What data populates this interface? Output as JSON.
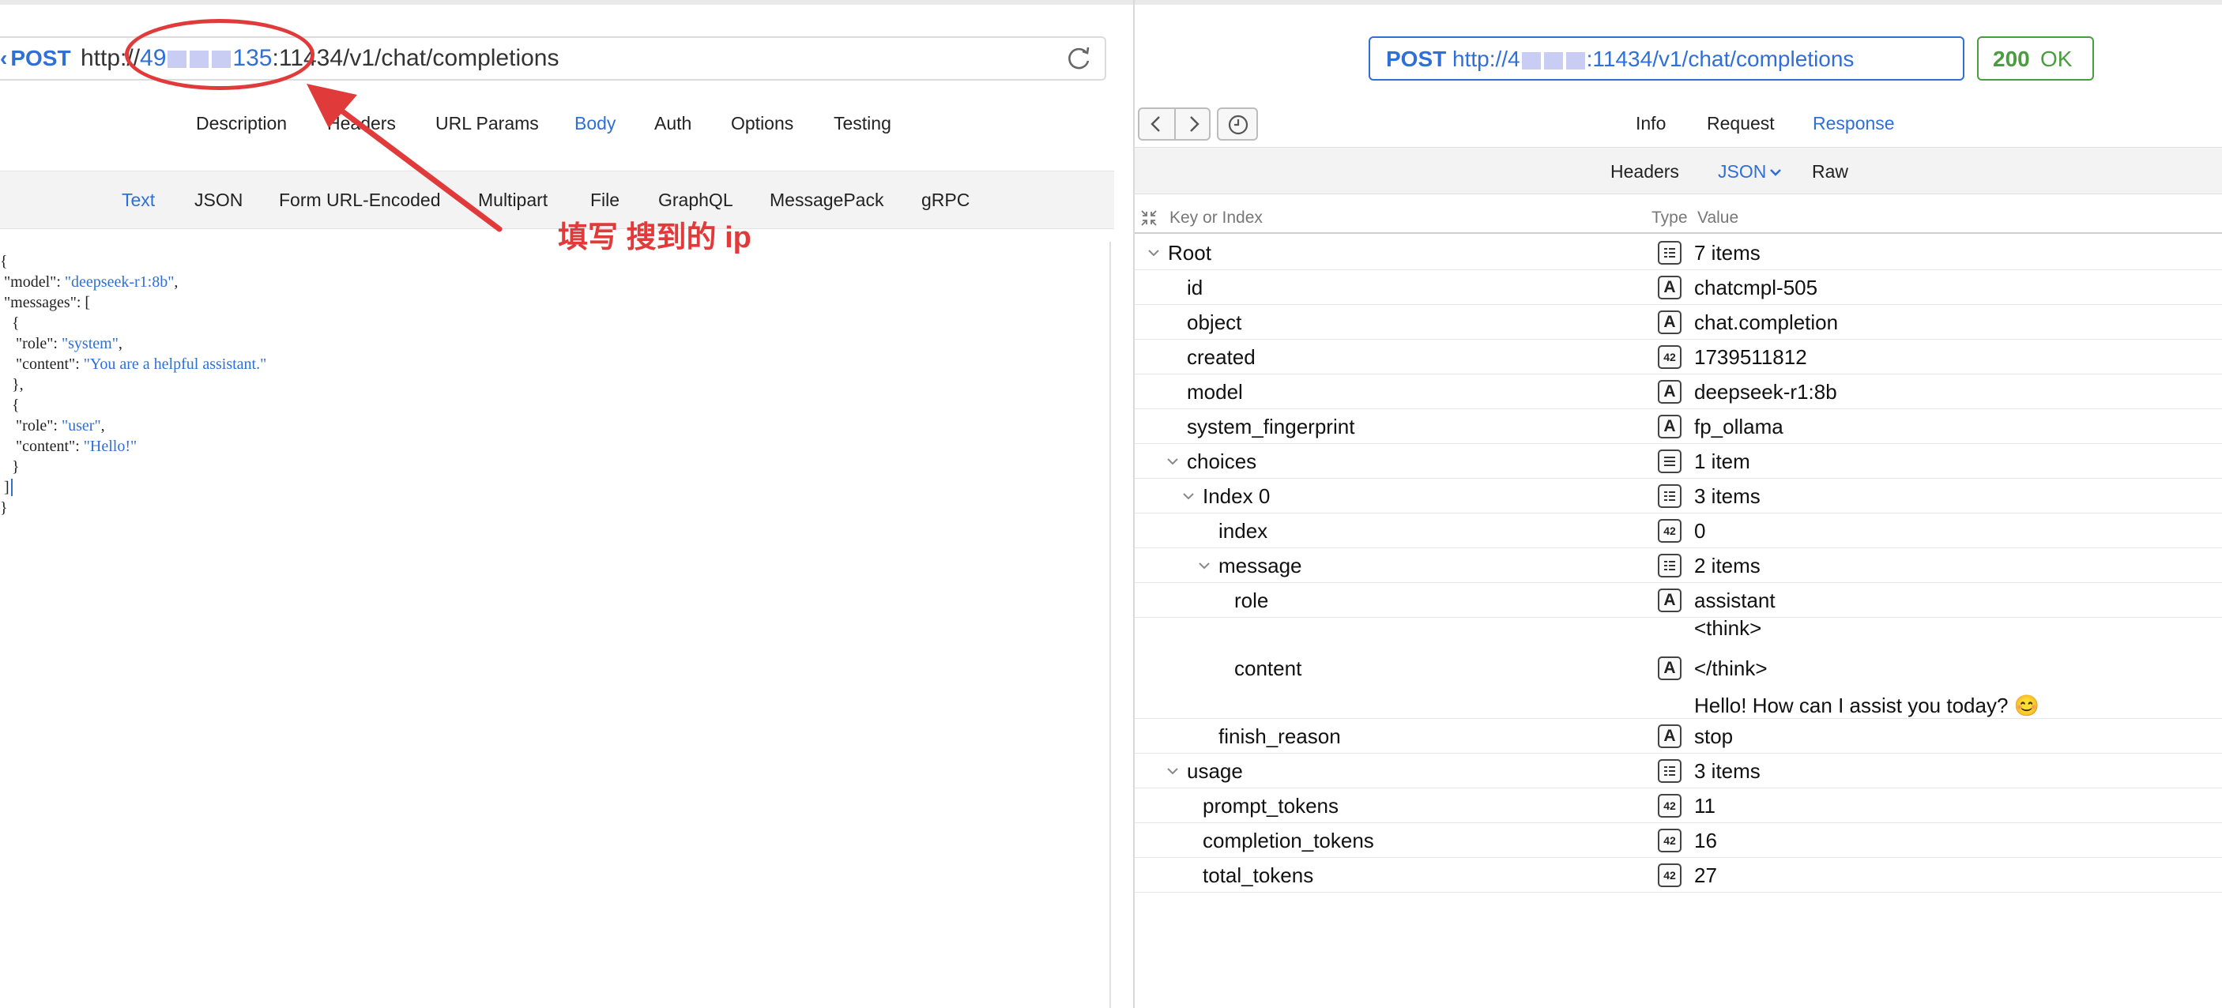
{
  "request": {
    "method": "POST",
    "url_prefix": "http://",
    "url_ip_fragment": "49",
    "url_ip_fragment2": "135",
    "url_suffix": ":11434/v1/chat/completions",
    "tabs": [
      "Description",
      "Headers",
      "URL Params",
      "Body",
      "Auth",
      "Options",
      "Testing"
    ],
    "active_tab": "Body",
    "body_types": [
      "Text",
      "JSON",
      "Form URL-Encoded",
      "Multipart",
      "File",
      "GraphQL",
      "MessagePack",
      "gRPC"
    ],
    "active_body_type": "Text",
    "body_lines": [
      {
        "indent": "",
        "key": "{",
        "value": "",
        "tail": ""
      },
      {
        "indent": " ",
        "key": "\"model\": ",
        "value": "\"deepseek-r1:8b\"",
        "tail": ","
      },
      {
        "indent": " ",
        "key": "\"messages\": [",
        "value": "",
        "tail": ""
      },
      {
        "indent": "   ",
        "key": "{",
        "value": "",
        "tail": ""
      },
      {
        "indent": "    ",
        "key": "\"role\": ",
        "value": "\"system\"",
        "tail": ","
      },
      {
        "indent": "    ",
        "key": "\"content\": ",
        "value": "\"You are a helpful assistant.\"",
        "tail": ""
      },
      {
        "indent": "   ",
        "key": "},",
        "value": "",
        "tail": ""
      },
      {
        "indent": "   ",
        "key": "{",
        "value": "",
        "tail": ""
      },
      {
        "indent": "    ",
        "key": "\"role\": ",
        "value": "\"user\"",
        "tail": ","
      },
      {
        "indent": "    ",
        "key": "\"content\": ",
        "value": "\"Hello!\"",
        "tail": ""
      },
      {
        "indent": "   ",
        "key": "}",
        "value": "",
        "tail": ""
      },
      {
        "indent": " ",
        "key": "]",
        "value": "",
        "tail": ""
      },
      {
        "indent": "",
        "key": "}",
        "value": "",
        "tail": ""
      }
    ]
  },
  "annotation": {
    "label": "填写 搜到的 ip",
    "color": "#e13a3a"
  },
  "response": {
    "method": "POST",
    "url_prefix": "http://4",
    "url_suffix": ":11434/v1/chat/completions",
    "status_code": "200",
    "status_text": "OK",
    "tabs": [
      "Info",
      "Request",
      "Response"
    ],
    "active_tab": "Response",
    "view_tabs": [
      "Headers",
      "JSON",
      "Raw"
    ],
    "active_view_tab": "JSON",
    "tree_headers": {
      "key": "Key or Index",
      "type": "Type",
      "value": "Value"
    },
    "tree": [
      {
        "key": "Root",
        "type": "dict",
        "value": "7 items",
        "depth": 0,
        "expanded": true
      },
      {
        "key": "id",
        "type": "string",
        "value": "chatcmpl-505",
        "depth": 1
      },
      {
        "key": "object",
        "type": "string",
        "value": "chat.completion",
        "depth": 1
      },
      {
        "key": "created",
        "type": "number",
        "value": "1739511812",
        "depth": 1
      },
      {
        "key": "model",
        "type": "string",
        "value": "deepseek-r1:8b",
        "depth": 1
      },
      {
        "key": "system_fingerprint",
        "type": "string",
        "value": "fp_ollama",
        "depth": 1
      },
      {
        "key": "choices",
        "type": "array",
        "value": "1 item",
        "depth": 1,
        "expanded": true
      },
      {
        "key": "Index 0",
        "type": "dict",
        "value": "3 items",
        "depth": 2,
        "expanded": true
      },
      {
        "key": "index",
        "type": "number",
        "value": "0",
        "depth": 3
      },
      {
        "key": "message",
        "type": "dict",
        "value": "2 items",
        "depth": 3,
        "expanded": true
      },
      {
        "key": "role",
        "type": "string",
        "value": "assistant",
        "depth": 4
      },
      {
        "key": "content",
        "type": "string",
        "value_lines": [
          "<think>",
          "</think>",
          "Hello! How can I assist you today? 😊"
        ],
        "depth": 4
      },
      {
        "key": "finish_reason",
        "type": "string",
        "value": "stop",
        "depth": 3
      },
      {
        "key": "usage",
        "type": "dict",
        "value": "3 items",
        "depth": 1,
        "expanded": true
      },
      {
        "key": "prompt_tokens",
        "type": "number",
        "value": "11",
        "depth": 2
      },
      {
        "key": "completion_tokens",
        "type": "number",
        "value": "16",
        "depth": 2
      },
      {
        "key": "total_tokens",
        "type": "number",
        "value": "27",
        "depth": 2
      }
    ]
  },
  "icons": {
    "reload": "reload-icon",
    "back": "chevron-left-icon",
    "forward": "chevron-right-icon",
    "history": "clock-icon",
    "collapse_all": "collapse-all-icon",
    "disclosure": "chevron-down-icon",
    "view_dropdown": "chevron-down-icon"
  },
  "colors": {
    "accent": "#2f6fd6",
    "ok": "#4a9d3f",
    "annotation": "#e13a3a"
  }
}
